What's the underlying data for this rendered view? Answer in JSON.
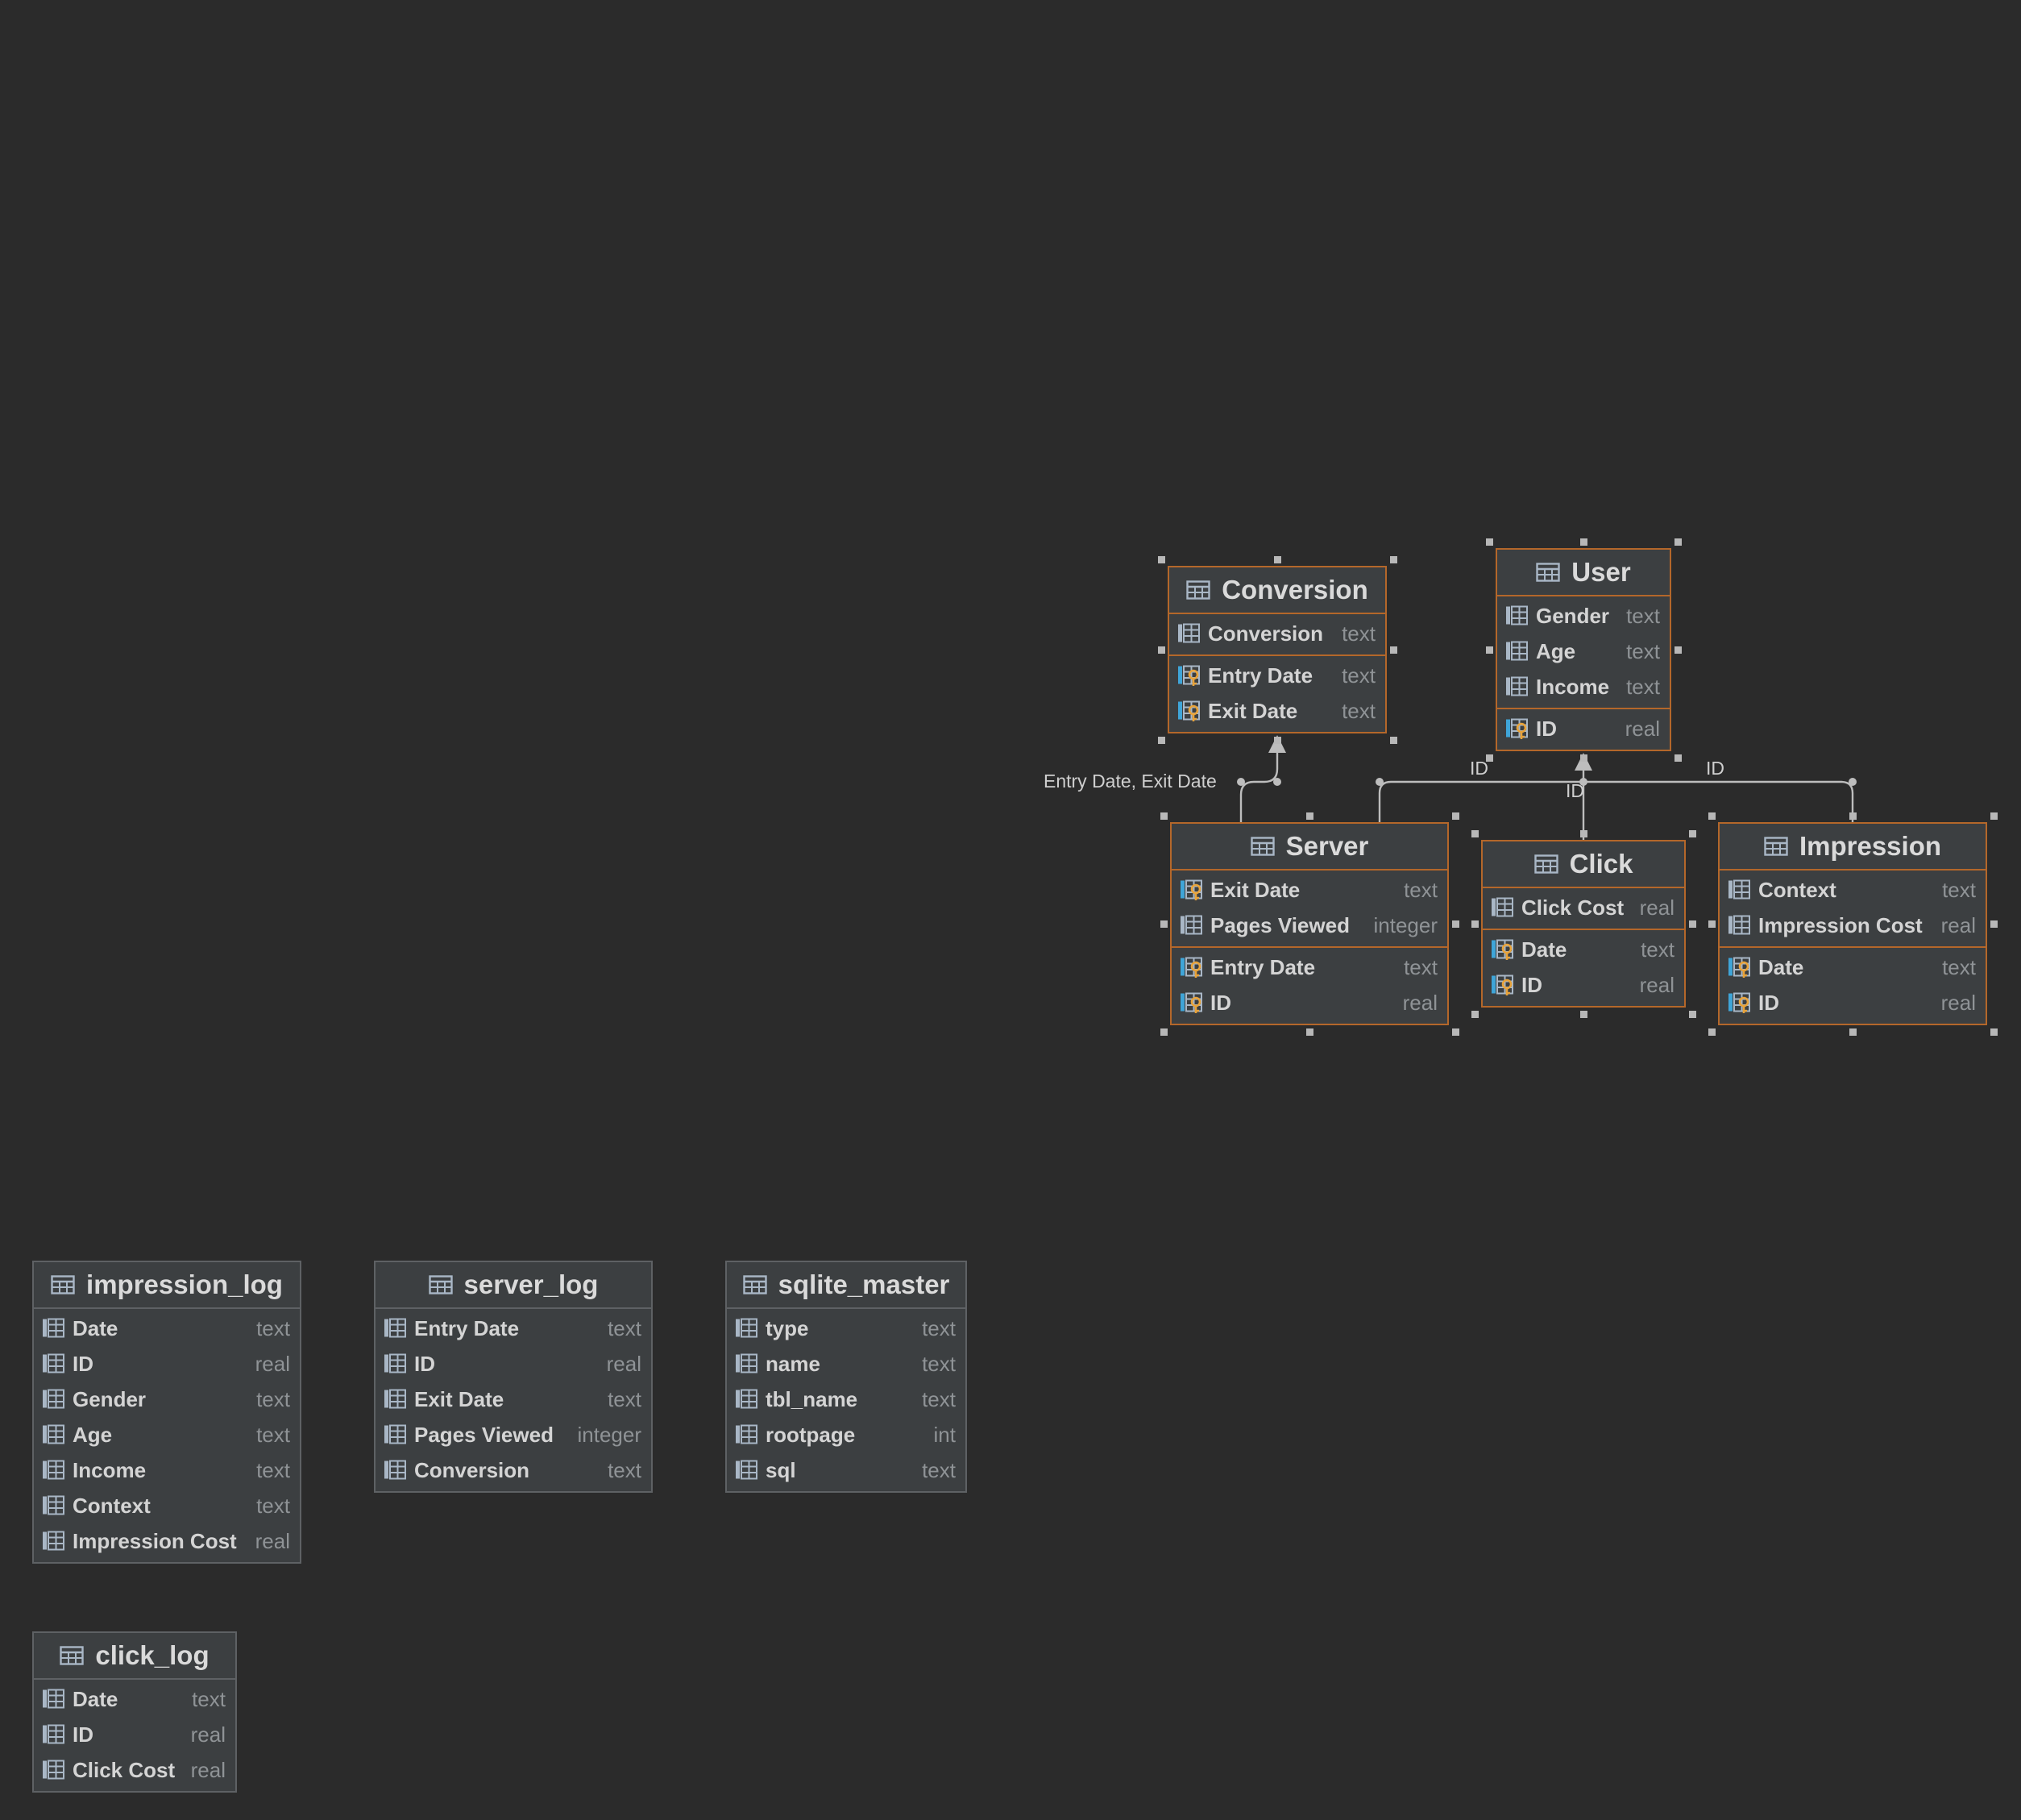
{
  "diagram": {
    "tables": [
      {
        "id": "conversion",
        "name": "Conversion",
        "selected": true,
        "groups": [
          [
            {
              "name": "Conversion",
              "type": "text",
              "icon": "column-icon"
            }
          ],
          [
            {
              "name": "Entry Date",
              "type": "text",
              "icon": "foreign-key-column-icon"
            },
            {
              "name": "Exit Date",
              "type": "text",
              "icon": "foreign-key-column-icon"
            }
          ]
        ]
      },
      {
        "id": "user",
        "name": "User",
        "selected": true,
        "groups": [
          [
            {
              "name": "Gender",
              "type": "text",
              "icon": "column-icon"
            },
            {
              "name": "Age",
              "type": "text",
              "icon": "column-icon"
            },
            {
              "name": "Income",
              "type": "text",
              "icon": "column-icon"
            }
          ],
          [
            {
              "name": "ID",
              "type": "real",
              "icon": "primary-key-column-icon"
            }
          ]
        ]
      },
      {
        "id": "server",
        "name": "Server",
        "selected": true,
        "groups": [
          [
            {
              "name": "Exit Date",
              "type": "text",
              "icon": "foreign-key-column-icon"
            },
            {
              "name": "Pages Viewed",
              "type": "integer",
              "icon": "column-icon"
            }
          ],
          [
            {
              "name": "Entry Date",
              "type": "text",
              "icon": "foreign-key-column-icon"
            },
            {
              "name": "ID",
              "type": "real",
              "icon": "foreign-key-column-icon"
            }
          ]
        ]
      },
      {
        "id": "click",
        "name": "Click",
        "selected": true,
        "groups": [
          [
            {
              "name": "Click Cost",
              "type": "real",
              "icon": "column-icon"
            }
          ],
          [
            {
              "name": "Date",
              "type": "text",
              "icon": "foreign-key-column-icon"
            },
            {
              "name": "ID",
              "type": "real",
              "icon": "foreign-key-column-icon"
            }
          ]
        ]
      },
      {
        "id": "impression",
        "name": "Impression",
        "selected": true,
        "groups": [
          [
            {
              "name": "Context",
              "type": "text",
              "icon": "column-icon"
            },
            {
              "name": "Impression Cost",
              "type": "real",
              "icon": "column-icon"
            }
          ],
          [
            {
              "name": "Date",
              "type": "text",
              "icon": "foreign-key-column-icon"
            },
            {
              "name": "ID",
              "type": "real",
              "icon": "foreign-key-column-icon"
            }
          ]
        ]
      },
      {
        "id": "impression_log",
        "name": "impression_log",
        "selected": false,
        "groups": [
          [
            {
              "name": "Date",
              "type": "text",
              "icon": "column-icon"
            },
            {
              "name": "ID",
              "type": "real",
              "icon": "column-icon"
            },
            {
              "name": "Gender",
              "type": "text",
              "icon": "column-icon"
            },
            {
              "name": "Age",
              "type": "text",
              "icon": "column-icon"
            },
            {
              "name": "Income",
              "type": "text",
              "icon": "column-icon"
            },
            {
              "name": "Context",
              "type": "text",
              "icon": "column-icon"
            },
            {
              "name": "Impression Cost",
              "type": "real",
              "icon": "column-icon"
            }
          ]
        ]
      },
      {
        "id": "server_log",
        "name": "server_log",
        "selected": false,
        "groups": [
          [
            {
              "name": "Entry Date",
              "type": "text",
              "icon": "column-icon"
            },
            {
              "name": "ID",
              "type": "real",
              "icon": "column-icon"
            },
            {
              "name": "Exit Date",
              "type": "text",
              "icon": "column-icon"
            },
            {
              "name": "Pages Viewed",
              "type": "integer",
              "icon": "column-icon"
            },
            {
              "name": "Conversion",
              "type": "text",
              "icon": "column-icon"
            }
          ]
        ]
      },
      {
        "id": "sqlite_master",
        "name": "sqlite_master",
        "selected": false,
        "groups": [
          [
            {
              "name": "type",
              "type": "text",
              "icon": "column-icon"
            },
            {
              "name": "name",
              "type": "text",
              "icon": "column-icon"
            },
            {
              "name": "tbl_name",
              "type": "text",
              "icon": "column-icon"
            },
            {
              "name": "rootpage",
              "type": "int",
              "icon": "column-icon"
            },
            {
              "name": "sql",
              "type": "text",
              "icon": "column-icon"
            }
          ]
        ]
      },
      {
        "id": "click_log",
        "name": "click_log",
        "selected": false,
        "groups": [
          [
            {
              "name": "Date",
              "type": "text",
              "icon": "column-icon"
            },
            {
              "name": "ID",
              "type": "real",
              "icon": "column-icon"
            },
            {
              "name": "Click Cost",
              "type": "real",
              "icon": "column-icon"
            }
          ]
        ]
      }
    ],
    "edges": [
      {
        "id": "server-conversion",
        "from": "Server",
        "to": "Conversion",
        "label": "Entry Date, Exit Date"
      },
      {
        "id": "server-user",
        "from": "Server",
        "to": "User",
        "label": "ID"
      },
      {
        "id": "click-user",
        "from": "Click",
        "to": "User",
        "label": "ID"
      },
      {
        "id": "impression-user",
        "from": "Impression",
        "to": "User",
        "label": "ID"
      }
    ],
    "colors": {
      "canvas": "#2b2b2b",
      "table_fill": "#3c3f41",
      "selected_border": "#b4672a",
      "edge": "#bdbdbd",
      "key_gold": "#e8a33a",
      "key_blue": "#3fa5d8"
    }
  }
}
